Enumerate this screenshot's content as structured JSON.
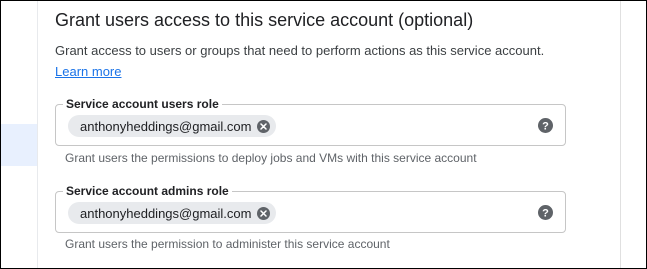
{
  "section": {
    "title": "Grant users access to this service account (optional)",
    "description": "Grant access to users or groups that need to perform actions as this service account.",
    "learn_more": "Learn more"
  },
  "users_role": {
    "label": "Service account users role",
    "chip": "anthonyheddings@gmail.com",
    "hint": "Grant users the permissions to deploy jobs and VMs with this service account"
  },
  "admins_role": {
    "label": "Service account admins role",
    "chip": "anthonyheddings@gmail.com",
    "hint": "Grant users the permission to administer this service account"
  },
  "colors": {
    "link": "#1a73e8",
    "chip_bg": "#e8eaed",
    "icon": "#5f6368",
    "border": "#c6c6c6"
  },
  "icons": {
    "chip_remove": "close-circle-icon",
    "help": "help-circle-icon"
  }
}
